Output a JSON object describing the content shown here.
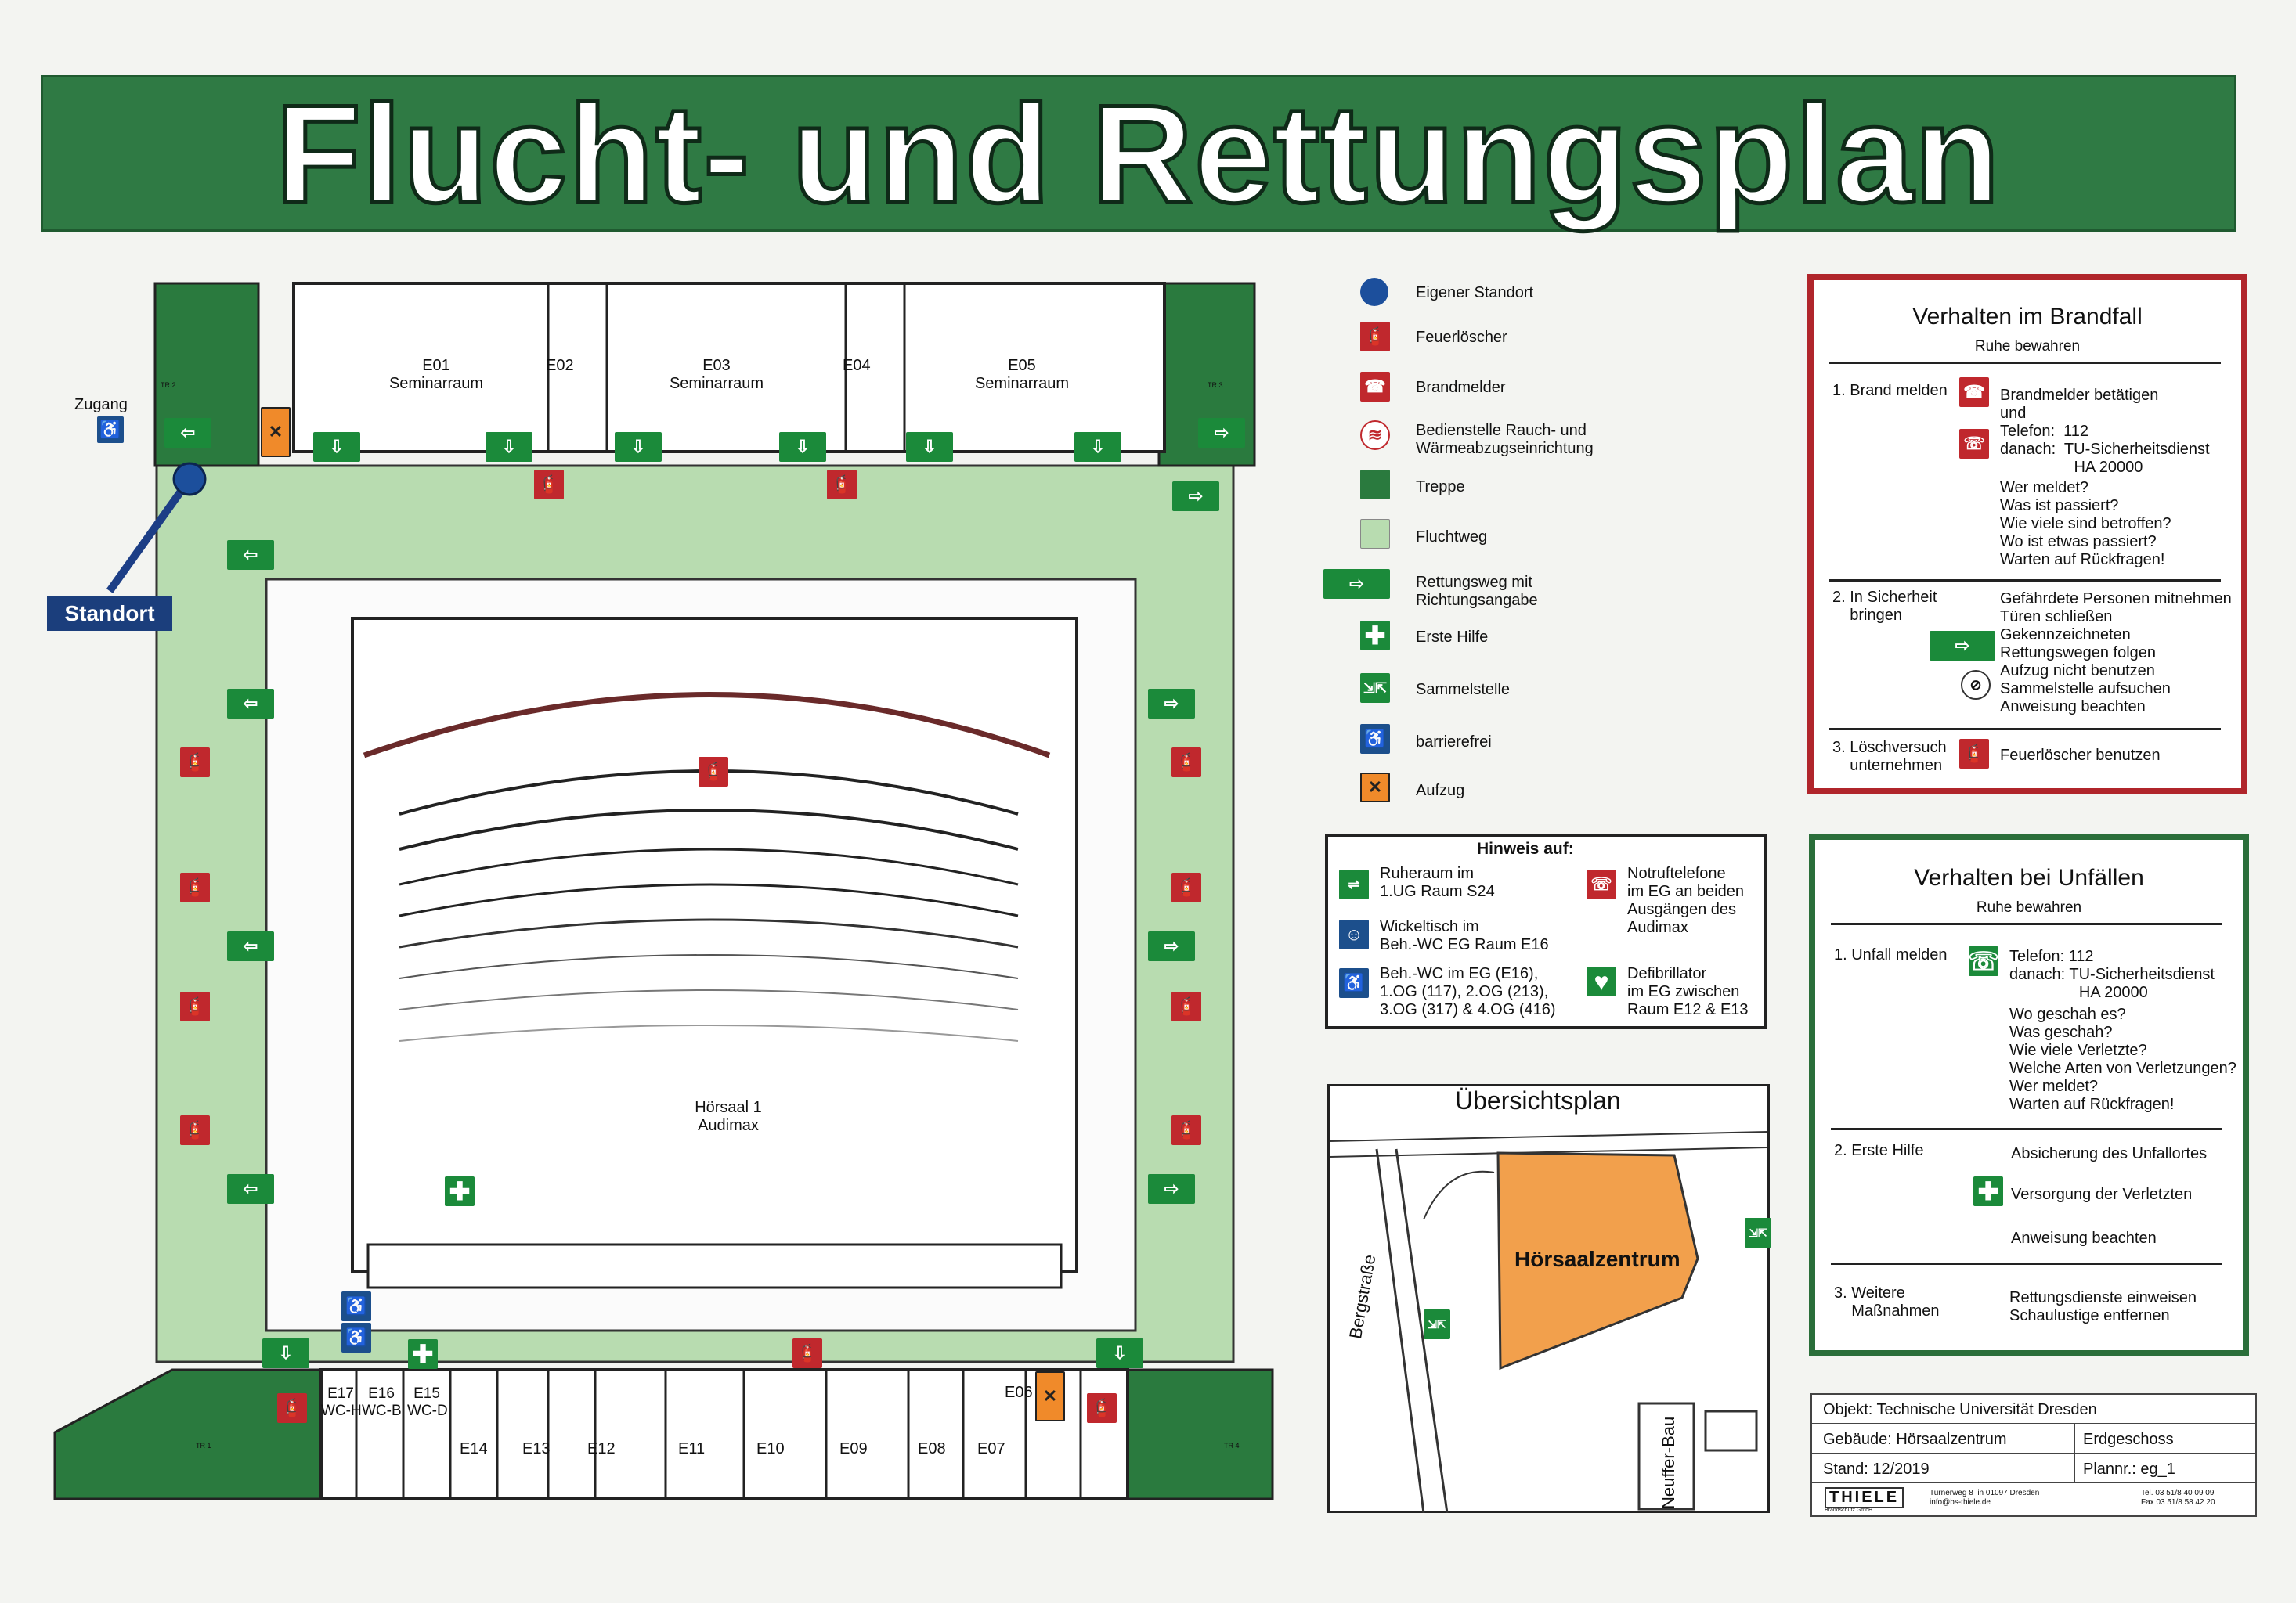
{
  "title": "Flucht- und Rettungsplan",
  "colors": {
    "escape_route": "#b8dcb0",
    "stairs": "#2a7a3e",
    "title_bg": "#2f7a44",
    "fire_box": "#b0252b",
    "accident_box": "#2a6e3a",
    "building_overview": "#f2a04c"
  },
  "floorplan": {
    "rooms_top": [
      "E01\nSeminarraum",
      "E02",
      "E03\nSeminarraum",
      "E04",
      "E05\nSeminarraum"
    ],
    "rooms_bottom": [
      "E17\nWC-H",
      "E16\nWC-B",
      "E15\nWC-D",
      "E14",
      "E13",
      "E12",
      "E11",
      "E10",
      "E09",
      "E08",
      "E07",
      "E06"
    ],
    "stair_labels": [
      "TR 2",
      "TR 3",
      "TR 1",
      "TR 4"
    ],
    "hall": "Hörsaal 1\nAudimax",
    "zugang": "Zugang",
    "standort": "Standort"
  },
  "legend": [
    {
      "icon": "own-location-icon",
      "label": "Eigener Standort"
    },
    {
      "icon": "fire-extinguisher-icon",
      "label": "Feuerlöscher"
    },
    {
      "icon": "fire-alarm-icon",
      "label": "Brandmelder"
    },
    {
      "icon": "smoke-vent-control-icon",
      "label": "Bedienstelle Rauch- und\nWärmeabzugseinrichtung"
    },
    {
      "icon": "stairs-icon",
      "label": "Treppe"
    },
    {
      "icon": "escape-route-icon",
      "label": "Fluchtweg"
    },
    {
      "icon": "emergency-exit-arrow-icon",
      "label": "Rettungsweg mit\nRichtungsangabe"
    },
    {
      "icon": "first-aid-icon",
      "label": "Erste Hilfe"
    },
    {
      "icon": "assembly-point-icon",
      "label": "Sammelstelle"
    },
    {
      "icon": "accessible-icon",
      "label": "barrierefrei"
    },
    {
      "icon": "elevator-icon",
      "label": "Aufzug"
    }
  ],
  "hinweis": {
    "title": "Hinweis auf:",
    "items": [
      "Ruheraum im\n1.UG Raum S24",
      "Notruftelefone\nim EG an beiden\nAusgängen des\nAudimax",
      "Wickeltisch im\nBeh.-WC EG Raum E16",
      "Beh.-WC im EG (E16),\n1.OG (117), 2.OG (213),\n3.OG (317) & 4.OG (416)",
      "Defibrillator\nim EG zwischen\nRaum E12 & E13"
    ]
  },
  "overview": {
    "title": "Übersichtsplan",
    "building": "Hörsaalzentrum",
    "street1": "Bergstraße",
    "street2": "Neuffer-Bau"
  },
  "fire": {
    "title": "Verhalten im Brandfall",
    "subtitle": "Ruhe bewahren",
    "s1_head": "1. Brand melden",
    "s1_body": "Brandmelder betätigen\nund\nTelefon:  112\ndanach:  TU-Sicherheitsdienst\n                 HA 20000",
    "s1_q": "Wer meldet?\nWas ist passiert?\nWie viele sind betroffen?\nWo ist etwas passiert?\nWarten auf Rückfragen!",
    "s2_head": "2. In Sicherheit\n    bringen",
    "s2_body": "Gefährdete Personen mitnehmen\nTüren schließen\nGekennzeichneten\nRettungswegen folgen\nAufzug nicht benutzen\nSammelstelle aufsuchen\nAnweisung beachten",
    "s3_head": "3. Löschversuch\n    unternehmen",
    "s3_body": "Feuerlöscher benutzen"
  },
  "accident": {
    "title": "Verhalten bei Unfällen",
    "subtitle": "Ruhe bewahren",
    "s1_head": "1. Unfall melden",
    "s1_body": "Telefon: 112\ndanach: TU-Sicherheitsdienst\n                HA 20000",
    "s1_q": "Wo geschah es?\nWas geschah?\nWie viele Verletzte?\nWelche Arten von Verletzungen?\nWer meldet?\nWarten auf Rückfragen!",
    "s2_head": "2. Erste Hilfe",
    "s2_a": "Absicherung des Unfallortes",
    "s2_b": "Versorgung der Verletzten",
    "s2_c": "Anweisung beachten",
    "s3_head": "3. Weitere\n    Maßnahmen",
    "s3_body": "Rettungsdienste einweisen\nSchaulustige entfernen"
  },
  "info": {
    "objekt": "Objekt: Technische Universität Dresden",
    "gebaeude": "Gebäude: Hörsaalzentrum",
    "geschoss": "Erdgeschoss",
    "stand": "Stand: 12/2019",
    "plannr": "Plannr.: eg_1",
    "company": "THIELE",
    "company_sub": "Brandschutz GmbH",
    "address": "Turnerweg 8  in 01097 Dresden\ninfo@bs-thiele.de",
    "phone": "Tel. 03 51/8 40 09 09\nFax 03 51/8 58 42 20"
  }
}
